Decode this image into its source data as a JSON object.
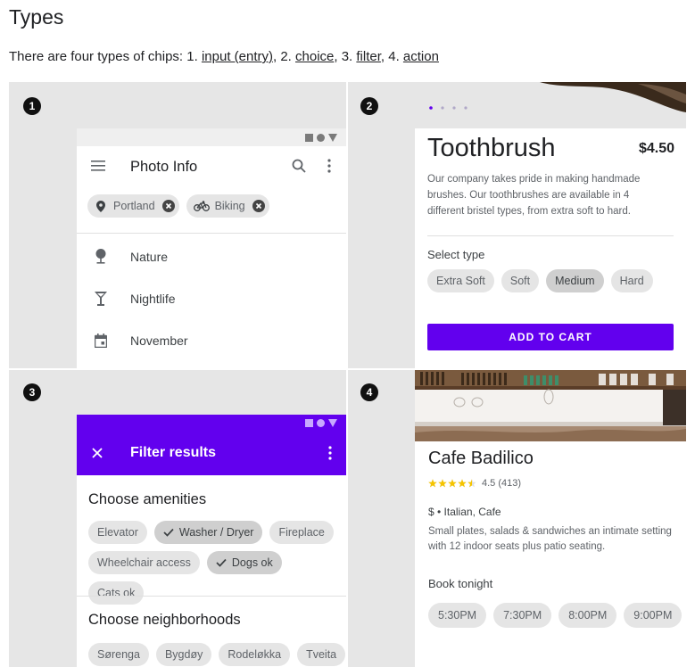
{
  "header": {
    "title": "Types",
    "intro_prefix": "There are four types of chips: 1. ",
    "link_input": "input (entry)",
    "sep2": ", 2. ",
    "link_choice": "choice",
    "sep3": ", 3. ",
    "link_filter": "filter",
    "sep4": ", 4. ",
    "link_action": "action"
  },
  "panels": {
    "p1": {
      "badge": "1",
      "app_title": "Photo Info",
      "icons": [
        "menu-icon",
        "search-icon",
        "more-vert-icon"
      ],
      "chips": [
        {
          "label": "Portland",
          "icon": "location-pin-icon"
        },
        {
          "label": "Biking",
          "icon": "bike-icon"
        }
      ],
      "list": [
        {
          "label": "Nature",
          "icon": "tree-icon"
        },
        {
          "label": "Nightlife",
          "icon": "cocktail-icon"
        },
        {
          "label": "November",
          "icon": "calendar-icon"
        }
      ]
    },
    "p2": {
      "badge": "2",
      "product": "Toothbrush",
      "price": "$4.50",
      "description": "Our company takes pride in making handmade brushes. Our toothbrushes are available in 4 different bristel types, from extra soft to hard.",
      "select_label": "Select type",
      "types": [
        "Extra Soft",
        "Soft",
        "Medium",
        "Hard"
      ],
      "selected_type": "Medium",
      "cta": "ADD TO CART",
      "accent": "#6200ee"
    },
    "p3": {
      "badge": "3",
      "bar_title": "Filter results",
      "amenities_title": "Choose amenities",
      "amenities": [
        "Elevator",
        "Washer / Dryer",
        "Fireplace",
        "Wheelchair access",
        "Dogs ok",
        "Cats ok"
      ],
      "amenities_selected": [
        "Washer / Dryer",
        "Dogs ok"
      ],
      "neighborhoods_title": "Choose neighborhoods",
      "neighborhoods": [
        "Sørenga",
        "Bygdøy",
        "Rodeløkka",
        "Tveita"
      ],
      "accent": "#6200ee"
    },
    "p4": {
      "badge": "4",
      "name": "Cafe Badilico",
      "rating_value": 4.5,
      "rating_text": "4.5 (413)",
      "meta": "$ • Italian, Cafe",
      "description": "Small plates, salads & sandwiches an intimate setting with 12 indoor seats plus patio seating.",
      "book_label": "Book tonight",
      "times": [
        "5:30PM",
        "7:30PM",
        "8:00PM",
        "9:00PM"
      ],
      "star_color": "#f5c400"
    }
  }
}
